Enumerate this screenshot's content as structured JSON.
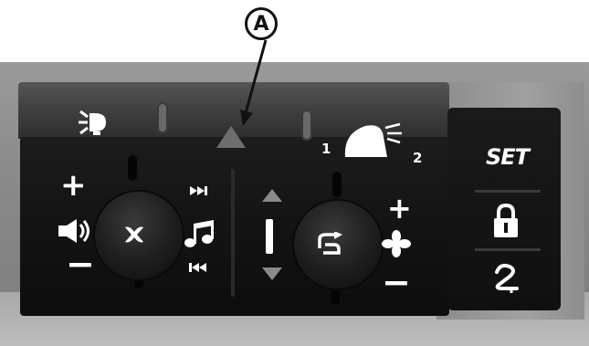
{
  "callout": {
    "label": "A"
  },
  "controls": {
    "volume_plus": "+",
    "volume_minus": "−",
    "fan_plus": "+",
    "fan_minus": "−",
    "wiper_level_1": "1",
    "wiper_level_2": "2",
    "set_label": "SET"
  },
  "icons": [
    "work-light-icon",
    "hazard-triangle-icon",
    "wiper-washer-icon",
    "speaker-volume-icon",
    "mute-icon",
    "next-track-icon",
    "music-note-icon",
    "previous-track-icon",
    "up-arrow-icon",
    "down-arrow-icon",
    "recirculation-icon",
    "fan-icon",
    "padlock-icon",
    "key-icon"
  ],
  "colors": {
    "panel": "#121212",
    "symbol": "#ffffff",
    "callout": "#111111"
  }
}
